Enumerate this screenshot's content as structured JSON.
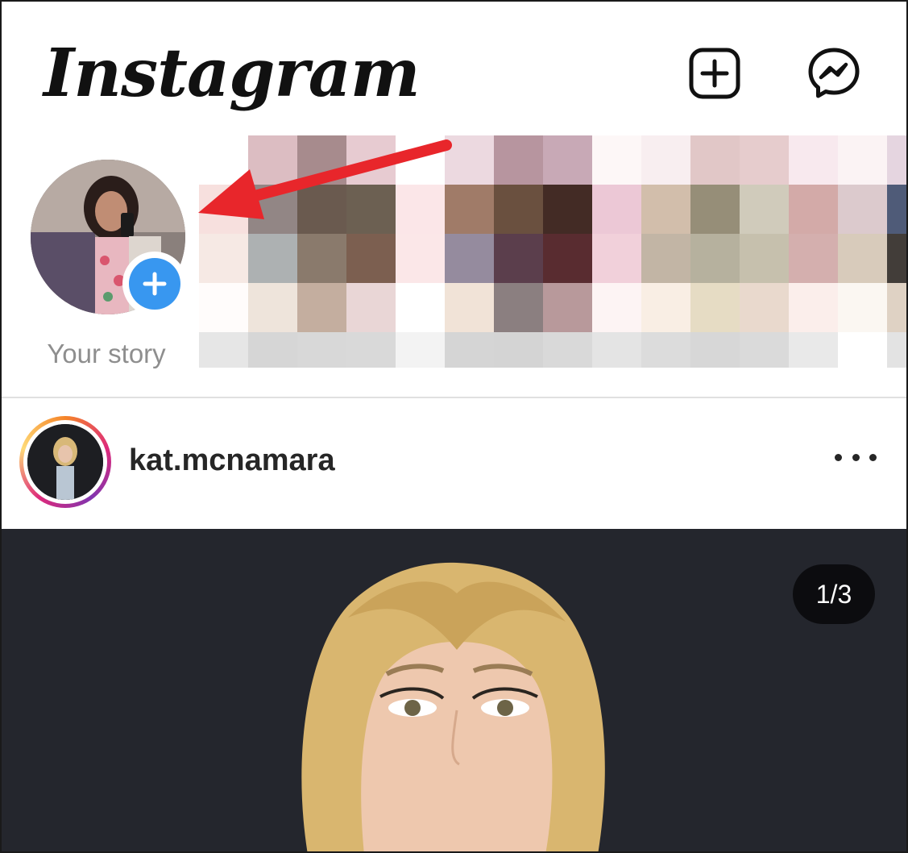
{
  "header": {
    "logo_text": "Instagram",
    "new_post_icon": "plus-square-icon",
    "messenger_icon": "messenger-icon"
  },
  "stories": {
    "your_story_label": "Your story",
    "add_icon": "plus-circle-icon",
    "other_stories_obscured": true
  },
  "post": {
    "username": "kat.mcnamara",
    "more_icon": "more-horizontal-icon",
    "carousel_counter": "1/3"
  },
  "annotation": {
    "arrow_color": "#e8262b"
  },
  "colors": {
    "accent_blue": "#3897f0",
    "text_primary": "#262626",
    "text_secondary": "#8e8e8e"
  }
}
